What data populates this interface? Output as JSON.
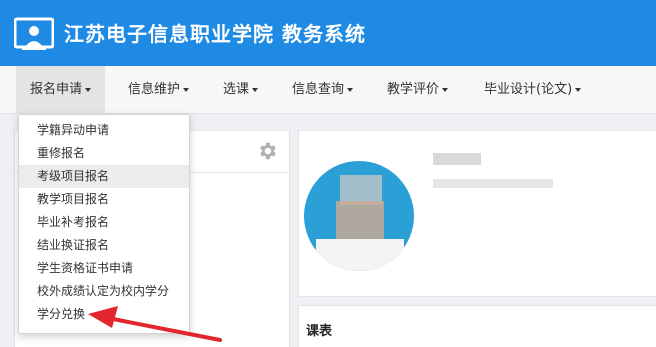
{
  "header": {
    "title": "江苏电子信息职业学院 教务系统",
    "logo_icon": "classroom-screen-logo-icon",
    "background": "#1f8ae3"
  },
  "nav": {
    "items": [
      {
        "label": "报名申请"
      },
      {
        "label": "信息维护"
      },
      {
        "label": "选课"
      },
      {
        "label": "信息查询"
      },
      {
        "label": "教学评价"
      },
      {
        "label": "毕业设计(论文)"
      }
    ],
    "active_index": 0
  },
  "dropdown": {
    "items": [
      {
        "label": "学籍异动申请"
      },
      {
        "label": "重修报名"
      },
      {
        "label": "考级项目报名"
      },
      {
        "label": "教学项目报名"
      },
      {
        "label": "毕业补考报名"
      },
      {
        "label": "结业换证报名"
      },
      {
        "label": "学生资格证书申请"
      },
      {
        "label": "校外成绩认定为校内学分"
      },
      {
        "label": "学分兑换"
      }
    ],
    "hovered_index": 2
  },
  "left_panel": {
    "settings_icon": "gear-icon"
  },
  "profile": {
    "avatar_icon": "user-avatar-photo-blurred"
  },
  "schedule": {
    "title": "课表"
  },
  "annotation": {
    "arrow_color": "#e3262e",
    "points_to": "学分兑换"
  }
}
